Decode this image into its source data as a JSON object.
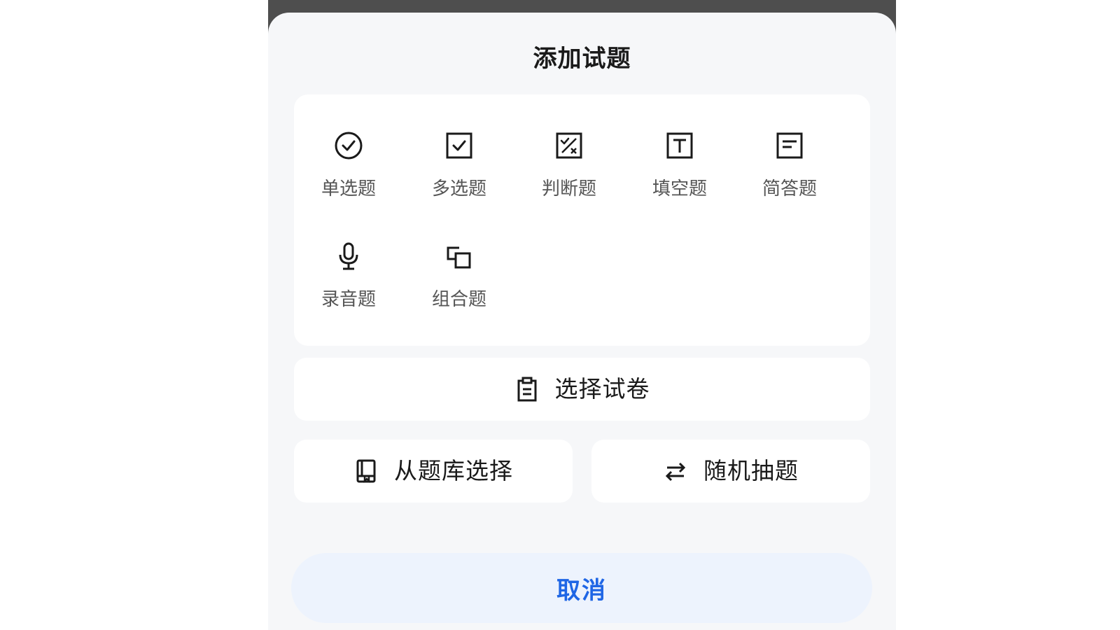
{
  "sheet": {
    "title": "添加试题"
  },
  "question_types": [
    {
      "label": "单选题",
      "icon": "radio-check-icon"
    },
    {
      "label": "多选题",
      "icon": "checkbox-icon"
    },
    {
      "label": "判断题",
      "icon": "true-false-icon"
    },
    {
      "label": "填空题",
      "icon": "text-box-icon"
    },
    {
      "label": "简答题",
      "icon": "lines-box-icon"
    },
    {
      "label": "录音题",
      "icon": "microphone-icon"
    },
    {
      "label": "组合题",
      "icon": "combine-icon"
    }
  ],
  "actions": {
    "select_paper": {
      "label": "选择试卷",
      "icon": "clipboard-icon"
    },
    "from_bank": {
      "label": "从题库选择",
      "icon": "book-icon"
    },
    "random_pick": {
      "label": "随机抽题",
      "icon": "swap-arrows-icon"
    }
  },
  "cancel": {
    "label": "取消"
  },
  "colors": {
    "accent": "#1f66e5",
    "cancel_bg": "#edf3fd",
    "sheet_bg": "#f6f7f9",
    "backdrop": "#4e4e4e"
  }
}
